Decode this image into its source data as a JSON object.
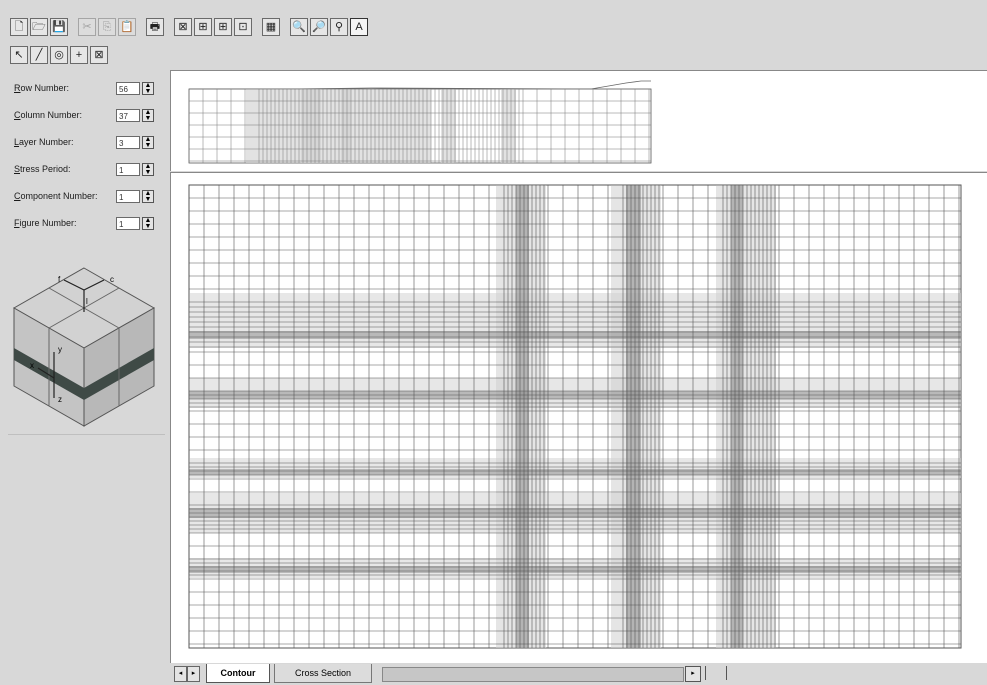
{
  "toolbar_row1": [
    {
      "name": "new-file-icon",
      "glyph": "🗋",
      "state": "normal"
    },
    {
      "name": "open-file-icon",
      "glyph": "🗁",
      "state": "normal"
    },
    {
      "name": "save-icon",
      "glyph": "💾",
      "state": "normal"
    },
    {
      "sep": true
    },
    {
      "name": "cut-icon",
      "glyph": "✂",
      "state": "disabled"
    },
    {
      "name": "copy-icon",
      "glyph": "⎘",
      "state": "disabled"
    },
    {
      "name": "paste-icon",
      "glyph": "📋",
      "state": "disabled"
    },
    {
      "sep": true
    },
    {
      "name": "print-icon",
      "glyph": "🖶",
      "state": "normal"
    },
    {
      "sep": true
    },
    {
      "name": "view-grid-icon",
      "glyph": "⊠",
      "state": "normal"
    },
    {
      "name": "view-rows-icon",
      "glyph": "⊞",
      "state": "normal"
    },
    {
      "name": "view-columns-icon",
      "glyph": "⊞",
      "state": "normal"
    },
    {
      "name": "view-layer-icon",
      "glyph": "⊡",
      "state": "normal"
    },
    {
      "sep": true
    },
    {
      "name": "color-fill-icon",
      "glyph": "▦",
      "state": "normal"
    },
    {
      "sep": true
    },
    {
      "name": "zoom-in-icon",
      "glyph": "🔍",
      "state": "normal"
    },
    {
      "name": "zoom-out-icon",
      "glyph": "🔎",
      "state": "normal"
    },
    {
      "name": "zoom-reset-icon",
      "glyph": "⚲",
      "state": "normal"
    },
    {
      "name": "annotate-icon",
      "glyph": "A",
      "state": "active"
    }
  ],
  "toolbar_row2": [
    {
      "name": "select-arrow-icon",
      "glyph": "↖",
      "state": "normal"
    },
    {
      "name": "draw-line-icon",
      "glyph": "╱",
      "state": "normal"
    },
    {
      "name": "target-icon",
      "glyph": "◎",
      "state": "normal"
    },
    {
      "name": "crosshair-icon",
      "glyph": "+",
      "state": "normal"
    },
    {
      "name": "delete-cell-icon",
      "glyph": "⊠",
      "state": "normal"
    }
  ],
  "fields": [
    {
      "label": "Row Number:",
      "value": "56"
    },
    {
      "label": "Column Number:",
      "value": "37"
    },
    {
      "label": "Layer Number:",
      "value": "3"
    },
    {
      "label": "Stress Period:",
      "value": "1"
    },
    {
      "label": "Component Number:",
      "value": "1"
    },
    {
      "label": "Figure Number:",
      "value": "1"
    }
  ],
  "cube_axes": [
    "f",
    "c",
    "l",
    "y",
    "x",
    "z"
  ],
  "tabs": {
    "contour": "Contour",
    "cross_section": "Cross Section"
  },
  "colors": {
    "band_light": "#cfcfcf",
    "band_dark": "#8c8c8c",
    "grid_line": "#555555",
    "cube_face": "#c8c8c8",
    "cube_band": "#3f4a46"
  }
}
